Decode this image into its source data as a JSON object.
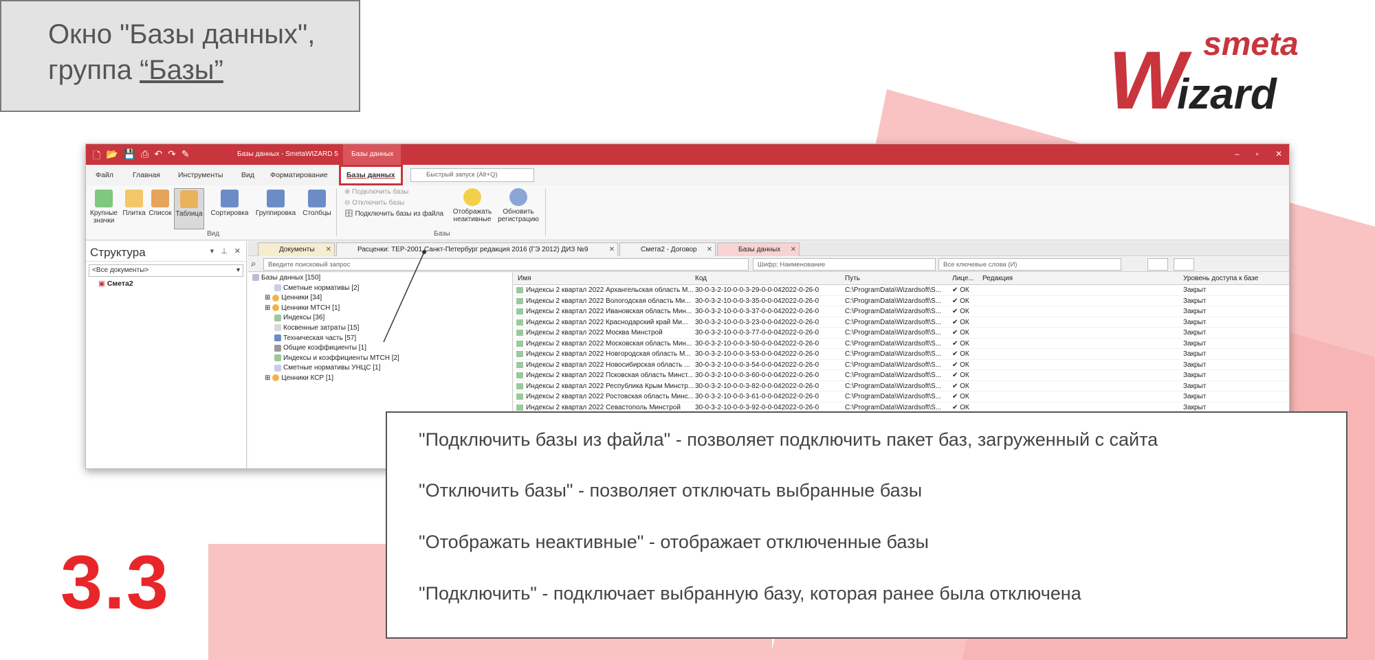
{
  "slide": {
    "title_line1": "Окно \"Базы данных\",",
    "title_line2_prefix": "группа ",
    "title_line2_link": "“Базы”",
    "section_number": "3.3",
    "logo_top": "smeta",
    "logo_bottom": "izard",
    "logo_initial": "W"
  },
  "colors": {
    "brand_red": "#c8353d",
    "accent_red": "#e8262a",
    "pink_bg": "#f7b8b8"
  },
  "app": {
    "window_title": "Базы данных - SmetaWIZARD 5",
    "context_tab": "Базы данных",
    "window_controls": [
      "–",
      "▫",
      "✕"
    ],
    "menu": [
      "Файл",
      "Главная",
      "Инструменты",
      "Вид",
      "Форматирование",
      "Базы данных"
    ],
    "quick_search_placeholder": "Быстрый запуск (Alt+Q)",
    "ribbon": {
      "view_buttons": [
        "Крупные значки",
        "Плитка",
        "Список",
        "Таблица",
        "Сортировка",
        "Группировка",
        "Столбцы"
      ],
      "view_group": "Вид",
      "bases_small": [
        "Подключить базы",
        "Отключить базы",
        "Подключить базы из файла"
      ],
      "show_inactive": "Отображать неактивные",
      "refresh_reg": "Обновить регистрацию",
      "bases_group": "Базы"
    },
    "left_panel": {
      "title": "Структура",
      "dropdown": "<Все документы>",
      "tree_item": "Смета2"
    },
    "tabs": [
      "Документы",
      "Расценки: ТЕР-2001 Санкт-Петербург редакция 2016 (ГЭ 2012) ДИЗ №9",
      "Смета2 - Договор",
      "Базы данных"
    ],
    "search": {
      "query_placeholder": "Введите поисковый запрос",
      "fields": "Шифр; Наименование",
      "keywords": "Все ключевые слова (И)"
    },
    "tree": [
      "Базы данных [150]",
      "Сметные нормативы [2]",
      "Ценники [34]",
      "Ценники МТСН [1]",
      "Индексы [36]",
      "Косвенные затраты [15]",
      "Техническая часть [57]",
      "Общие коэффициенты [1]",
      "Индексы и коэффициенты МТСН [2]",
      "Сметные нормативы УНЦС [1]",
      "Ценники КСР [1]"
    ],
    "grid_headers": [
      "Имя",
      "Код",
      "Путь",
      "Лице...",
      "Редакция",
      "Уровень доступа к базе"
    ],
    "grid_rows": [
      {
        "name": "Индексы 2 квартал 2022 Архангельская область М...",
        "code": "30-0-3-2-10-0-0-3-29-0-0-042022-0-26-0",
        "path": "C:\\ProgramData\\Wizardsoft\\S...",
        "lic": "✔ ОК",
        "access": "Закрыт"
      },
      {
        "name": "Индексы 2 квартал 2022 Вологодская область Ми...",
        "code": "30-0-3-2-10-0-0-3-35-0-0-042022-0-26-0",
        "path": "C:\\ProgramData\\Wizardsoft\\S...",
        "lic": "✔ ОК",
        "access": "Закрыт"
      },
      {
        "name": "Индексы 2 квартал 2022 Ивановская область Мин...",
        "code": "30-0-3-2-10-0-0-3-37-0-0-042022-0-26-0",
        "path": "C:\\ProgramData\\Wizardsoft\\S...",
        "lic": "✔ ОК",
        "access": "Закрыт"
      },
      {
        "name": "Индексы 2 квартал 2022 Краснодарский край Ми...",
        "code": "30-0-3-2-10-0-0-3-23-0-0-042022-0-26-0",
        "path": "C:\\ProgramData\\Wizardsoft\\S...",
        "lic": "✔ ОК",
        "access": "Закрыт"
      },
      {
        "name": "Индексы 2 квартал 2022 Москва Минстрой",
        "code": "30-0-3-2-10-0-0-3-77-0-0-042022-0-26-0",
        "path": "C:\\ProgramData\\Wizardsoft\\S...",
        "lic": "✔ ОК",
        "access": "Закрыт"
      },
      {
        "name": "Индексы 2 квартал 2022 Московская область Мин...",
        "code": "30-0-3-2-10-0-0-3-50-0-0-042022-0-26-0",
        "path": "C:\\ProgramData\\Wizardsoft\\S...",
        "lic": "✔ ОК",
        "access": "Закрыт"
      },
      {
        "name": "Индексы 2 квартал 2022 Новгородская область М...",
        "code": "30-0-3-2-10-0-0-3-53-0-0-042022-0-26-0",
        "path": "C:\\ProgramData\\Wizardsoft\\S...",
        "lic": "✔ ОК",
        "access": "Закрыт"
      },
      {
        "name": "Индексы 2 квартал 2022 Новосибирская область ...",
        "code": "30-0-3-2-10-0-0-3-54-0-0-042022-0-26-0",
        "path": "C:\\ProgramData\\Wizardsoft\\S...",
        "lic": "✔ ОК",
        "access": "Закрыт"
      },
      {
        "name": "Индексы 2 квартал 2022 Псковская область Минст...",
        "code": "30-0-3-2-10-0-0-3-60-0-0-042022-0-26-0",
        "path": "C:\\ProgramData\\Wizardsoft\\S...",
        "lic": "✔ ОК",
        "access": "Закрыт"
      },
      {
        "name": "Индексы 2 квартал 2022 Республика Крым Минстр...",
        "code": "30-0-3-2-10-0-0-3-82-0-0-042022-0-26-0",
        "path": "C:\\ProgramData\\Wizardsoft\\S...",
        "lic": "✔ ОК",
        "access": "Закрыт"
      },
      {
        "name": "Индексы 2 квартал 2022 Ростовская область Минс...",
        "code": "30-0-3-2-10-0-0-3-61-0-0-042022-0-26-0",
        "path": "C:\\ProgramData\\Wizardsoft\\S...",
        "lic": "✔ ОК",
        "access": "Закрыт"
      },
      {
        "name": "Индексы 2 квартал 2022 Севастополь Минстрой",
        "code": "30-0-3-2-10-0-0-3-92-0-0-042022-0-26-0",
        "path": "C:\\ProgramData\\Wizardsoft\\S...",
        "lic": "✔ ОК",
        "access": "Закрыт"
      }
    ]
  },
  "callout": [
    "\"Подключить базы из файла\" - позволяет подключить пакет баз, загруженный с сайта",
    "\"Отключить базы\" - позволяет отключать выбранные базы",
    "\"Отображать неактивные\" - отображает отключенные базы",
    "\"Подключить\" - подключает выбранную базу, которая ранее была отключена"
  ]
}
